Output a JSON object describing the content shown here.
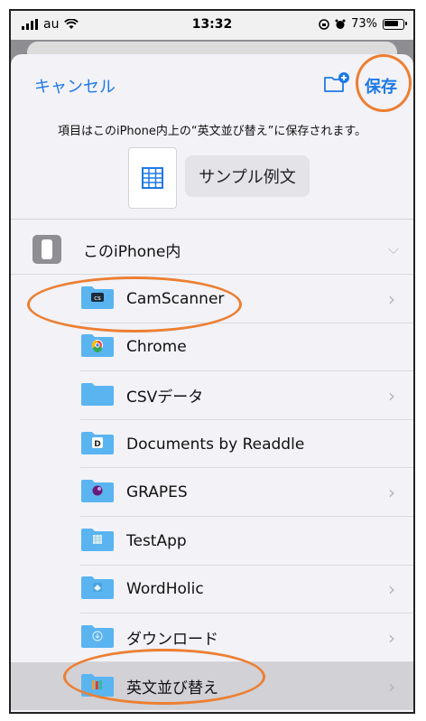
{
  "status": {
    "carrier": "au",
    "time": "13:32",
    "battery_pct": "73%"
  },
  "header": {
    "cancel_label": "キャンセル",
    "save_label": "保存",
    "info_text": "項目はこのiPhone内上の“英文並び替え”に保存されます。",
    "filename": "サンプル例文"
  },
  "location": {
    "root_label": "このiPhone内"
  },
  "folders": [
    {
      "label": "CamScanner",
      "icon": "camscanner-icon",
      "chevron": true
    },
    {
      "label": "Chrome",
      "icon": "chrome-icon",
      "chevron": false
    },
    {
      "label": "CSVデータ",
      "icon": "folder-icon",
      "chevron": true
    },
    {
      "label": "Documents by Readdle",
      "icon": "readdle-icon",
      "chevron": false
    },
    {
      "label": "GRAPES",
      "icon": "grapes-icon",
      "chevron": true
    },
    {
      "label": "TestApp",
      "icon": "testapp-icon",
      "chevron": false
    },
    {
      "label": "WordHolic",
      "icon": "wordholic-icon",
      "chevron": true
    },
    {
      "label": "ダウンロード",
      "icon": "download-icon",
      "chevron": true
    },
    {
      "label": "英文並び替え",
      "icon": "eibun-icon",
      "chevron": true,
      "selected": true
    }
  ],
  "colors": {
    "accent": "#1e79e6",
    "highlight_ring": "#ec7f32",
    "folder": "#5ab4f0"
  }
}
